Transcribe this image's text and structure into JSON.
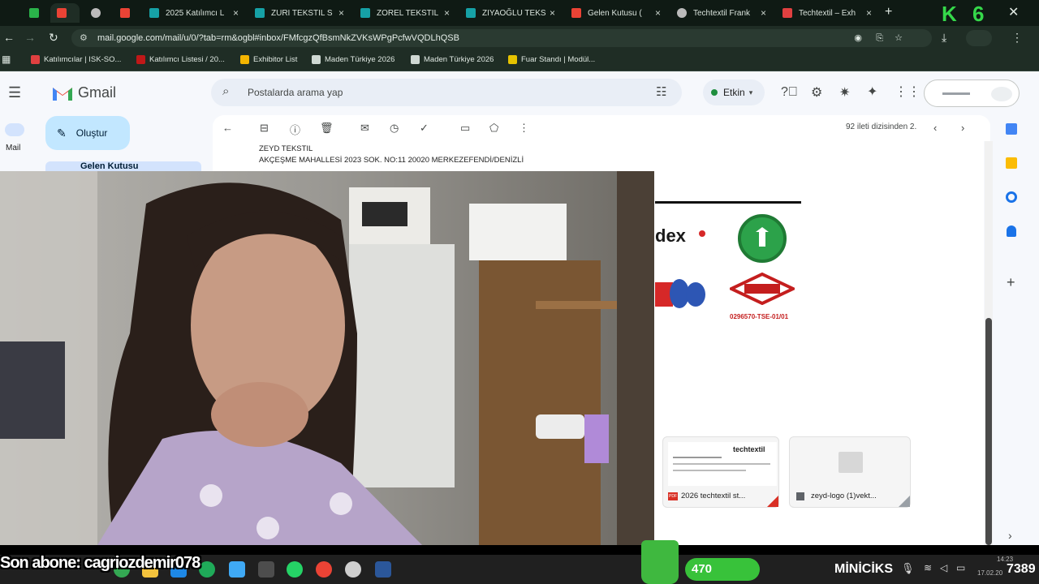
{
  "tabs": [
    {
      "label": "",
      "color": "#2ab34a"
    },
    {
      "label": "",
      "color": "#ea4335"
    },
    {
      "label": "",
      "color": "#bbbbbb"
    },
    {
      "label": "",
      "color": "#ea4335"
    },
    {
      "label": "2025 Katılımcı L",
      "color": "#16a1a6"
    },
    {
      "label": "ZURI TEKSTIL S",
      "color": "#16a1a6"
    },
    {
      "label": "ZOREL TEKSTIL",
      "color": "#16a1a6"
    },
    {
      "label": "ZIYAOĞLU TEKS",
      "color": "#16a1a6"
    },
    {
      "label": "Gelen Kutusu (",
      "color": "#ea4335"
    },
    {
      "label": "Techtextil Frank",
      "color": "#bbbbbb"
    },
    {
      "label": "Techtextil – Exh",
      "color": "#e04040"
    }
  ],
  "browser": {
    "url": "mail.google.com/mail/u/0/?tab=rm&ogbl#inbox/FMfcgzQfBsmNkZVKsWPgPcfwVQDLhQSB",
    "bookmarks": [
      "Katılımcılar | ISK-SO...",
      "Katılımcı Listesi / 20...",
      "Exhibitor List",
      "Maden Türkiye 2026",
      "Maden Türkiye 2026",
      "Fuar Standı | Modül..."
    ],
    "overlay_badge": "K 6"
  },
  "gmail": {
    "product": "Gmail",
    "compose": "Oluştur",
    "mail_label": "Mail",
    "inbox_label": "Gelen Kutusu",
    "search_placeholder": "Postalarda arama yap",
    "status": "Etkin",
    "pager": "92 ileti dizisinden 2.",
    "sender_name": "ZEYD TEKSTIL",
    "sender_address": "AKÇEŞME MAHALLESİ 2023 SOK. NO:11 20020 MERKEZEFENDİ/DENİZLİ",
    "cert_fragment": "dex",
    "tse_code": "0296570-TSE-01/01",
    "attachments": [
      {
        "name": "2026 techtextil st...",
        "type": "PDF",
        "preview": "techtextil"
      },
      {
        "name": "zeyd-logo (1)vekt...",
        "type": "doc",
        "preview": ""
      }
    ]
  },
  "stream": {
    "subscriber_text": "Son abone: cagriozdemir078",
    "counter": "470",
    "username": "MİNİCİKS",
    "score": "7389",
    "date": "17.02.20",
    "time": "14:23"
  },
  "colors": {
    "chrome_bg": "#0f1a14",
    "gmail_bg": "#f6f8fc",
    "compose_bg": "#c2e7ff",
    "status_green": "#1e8e3e",
    "counter_green": "#38c23a"
  }
}
